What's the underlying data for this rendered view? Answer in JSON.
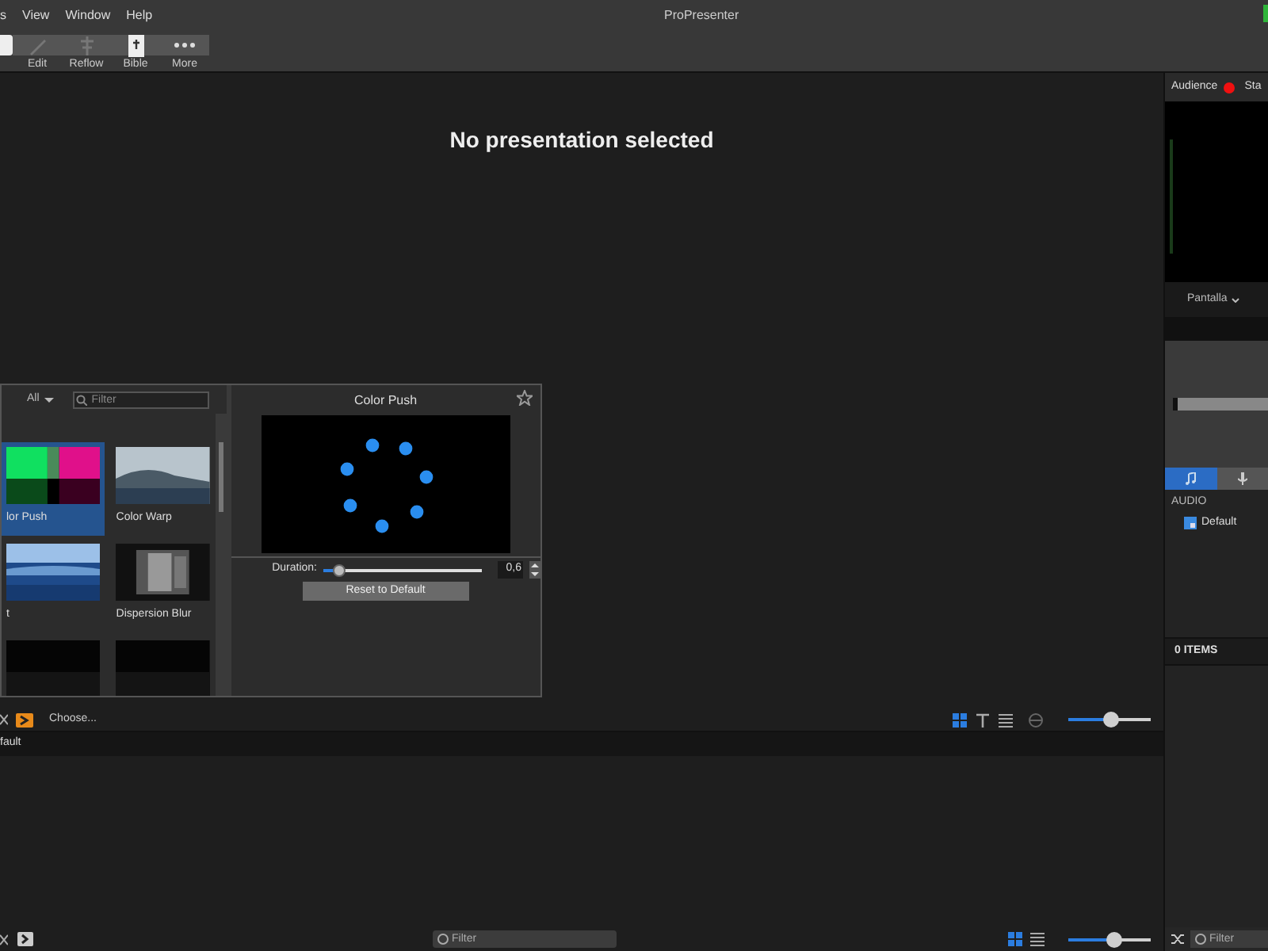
{
  "menu": [
    "s",
    "View",
    "Window",
    "Help"
  ],
  "window": {
    "title": "ProPresenter"
  },
  "toolbar": [
    {
      "label": "Edit",
      "kind": "pencil"
    },
    {
      "label": "Reflow",
      "kind": "reflow"
    },
    {
      "label": "Bible",
      "kind": "bible"
    },
    {
      "label": "More",
      "kind": "more"
    }
  ],
  "stage": {
    "message": "No presentation selected"
  },
  "transitions": {
    "filter_menu": "All",
    "search": {
      "placeholder": "Filter"
    },
    "items": [
      {
        "label": "lor Push",
        "selected": true,
        "kind": "bars"
      },
      {
        "label": "Color Warp",
        "selected": false,
        "kind": "landscape"
      },
      {
        "label": "t",
        "selected": false,
        "kind": "sea"
      },
      {
        "label": "Dispersion Blur",
        "selected": false,
        "kind": "blur"
      },
      {
        "selected": false,
        "kind": "dark"
      },
      {
        "selected": false,
        "kind": "dark"
      }
    ],
    "detail": {
      "title": "Color Push",
      "duration_label": "Duration:",
      "duration": {
        "level": 0.1
      },
      "duration_value": "0,6",
      "reset_button": "Reset to Default"
    }
  },
  "library_bar": {
    "choose": "Choose...",
    "zoom": {
      "level": 0.52
    }
  },
  "playlist": {
    "row": "fault"
  },
  "bottom_bar": {
    "search": {
      "placeholder": "Filter"
    },
    "zoom": {
      "level": 0.55
    }
  },
  "right": {
    "audience": "Audience",
    "stage": "Sta",
    "screen_menu": "Pantalla",
    "tabs": [
      {
        "kind": "music",
        "selected": true
      },
      {
        "kind": "mic",
        "selected": false
      }
    ],
    "audio_heading": "AUDIO",
    "audio_items": [
      "Default"
    ],
    "count": "0 ITEMS",
    "search": {
      "placeholder": "Filter"
    }
  }
}
